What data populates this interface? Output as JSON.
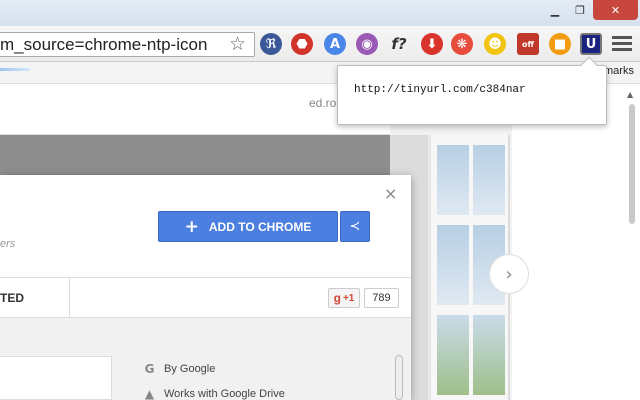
{
  "window": {
    "minimize_glyph": "▁",
    "maximize_glyph": "❐",
    "close_glyph": "✕"
  },
  "toolbar": {
    "omnibox_value": "m_source=chrome-ntp-icon",
    "star_icon": "☆",
    "extensions": [
      {
        "name": "rss-icon",
        "glyph": "ℜ",
        "color": "#3b5998"
      },
      {
        "name": "stop-icon",
        "glyph": "⬣",
        "color": "#d2332a"
      },
      {
        "name": "translate-icon",
        "glyph": "A",
        "color": "#4a86e8"
      },
      {
        "name": "color-wheel-icon",
        "glyph": "◉",
        "color": "#9b59b6"
      },
      {
        "name": "formula-icon",
        "glyph": "f?",
        "color": "#333333"
      },
      {
        "name": "download-icon",
        "glyph": "⬇",
        "color": "#d9342b"
      },
      {
        "name": "color-picker-icon",
        "glyph": "❋",
        "color": "#e74c3c"
      },
      {
        "name": "cat-icon",
        "glyph": "☻",
        "color": "#f1c40f"
      },
      {
        "name": "bomb-off-icon",
        "glyph": "off",
        "color": "#c0392b"
      },
      {
        "name": "cube-icon",
        "glyph": "■",
        "color": "#f39c12"
      },
      {
        "name": "tinyurl-icon",
        "glyph": "U",
        "color": "#1a237e"
      }
    ]
  },
  "bookmarks": {
    "label": "marks"
  },
  "page": {
    "domain_text": "ed.ro",
    "add_button_label": "ADD TO CHROME",
    "add_button_plus": "+",
    "share_glyph": "≺",
    "close_glyph": "×",
    "subtext": "ers",
    "tab_label": "TED",
    "gplus_label": "+1",
    "gplus_g": "g",
    "gplus_count": "789",
    "meta": [
      {
        "icon": "G",
        "text": "By Google"
      },
      {
        "icon": "▲",
        "text": "Works with Google Drive"
      }
    ],
    "arrow_glyph": "›"
  },
  "popup": {
    "url": "http://tinyurl.com/c384nar"
  },
  "colors": {
    "accent": "#4d7fe0",
    "close_red": "#c7463d"
  }
}
